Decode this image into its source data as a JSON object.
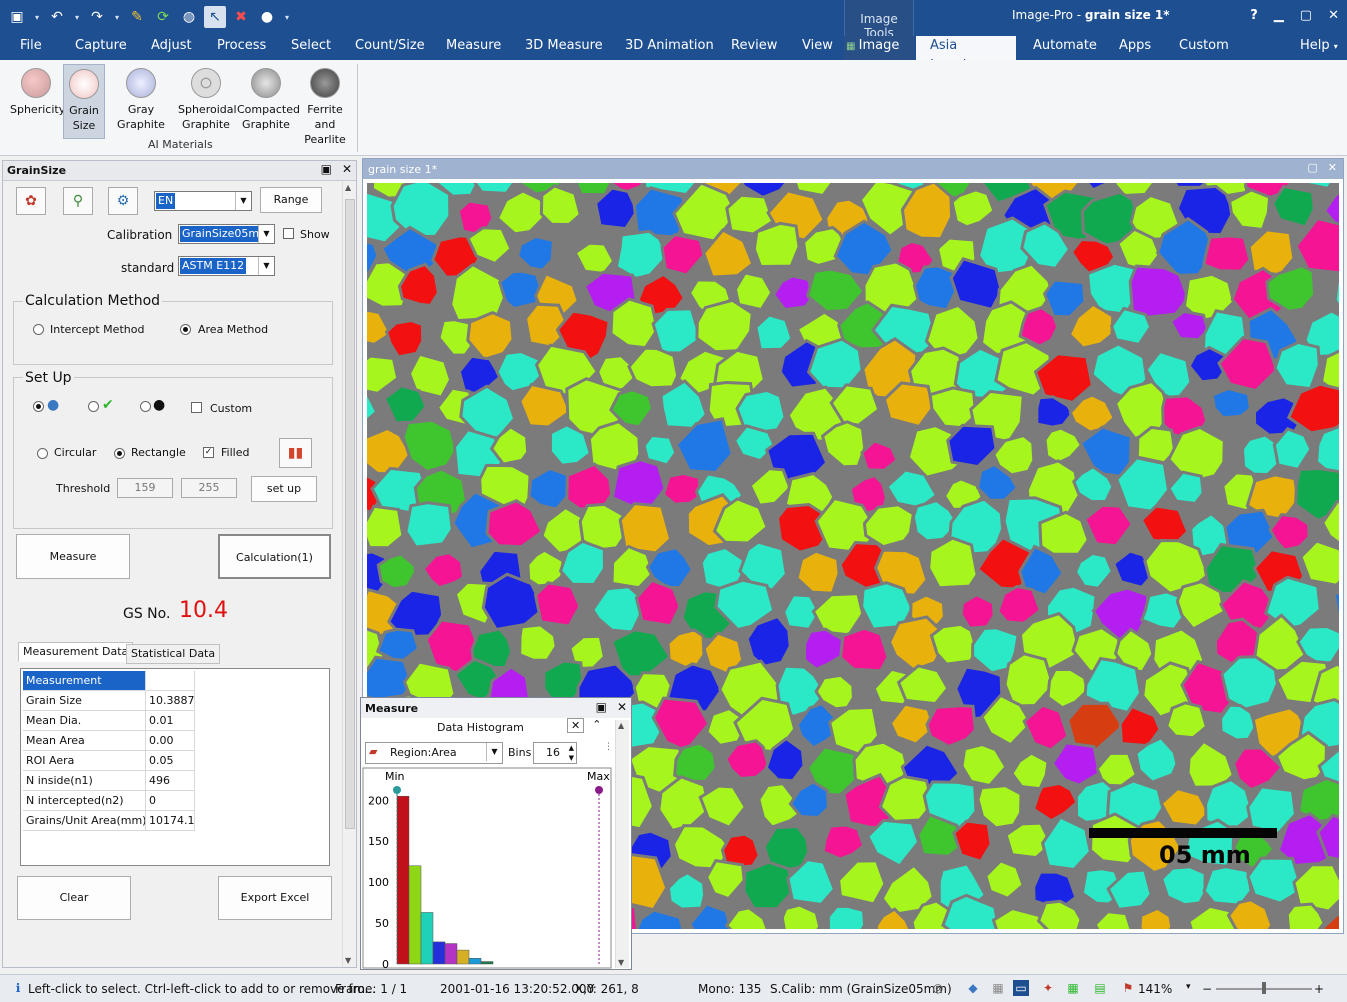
{
  "titlebar": {
    "image_tools": "Image Tools",
    "app_name": "Image-Pro - ",
    "doc_name": "grain size 1*",
    "controls": [
      "?",
      "▁",
      "▢",
      "✕"
    ]
  },
  "menu": [
    "File",
    "Capture",
    "Adjust",
    "Process",
    "Select",
    "Count/Size",
    "Measure",
    "3D Measure",
    "3D Animation",
    "Review",
    "View",
    "Image",
    "Asia Imaging",
    "Automate",
    "Apps",
    "Custom",
    "Help"
  ],
  "ribbon": {
    "buttons": [
      "Sphericity",
      "Grain Size",
      "Gray Graphite",
      "Spheroidal Graphite",
      "Compacted Graphite",
      "Ferrite and Pearlite"
    ],
    "group": "AI Materials"
  },
  "grain_panel": {
    "title": "GrainSize",
    "language": "EN",
    "range_btn": "Range",
    "calibration_label": "Calibration",
    "calibration_value": "GrainSize05mm",
    "show_label": "Show",
    "standard_label": "standard",
    "standard_value": "ASTM E112",
    "calc_method_title": "Calculation Method",
    "intercept_label": "Intercept Method",
    "area_label": "Area Method",
    "setup_title": "Set Up",
    "custom_label": "Custom",
    "circular_label": "Circular",
    "rectangle_label": "Rectangle",
    "filled_label": "Filled",
    "threshold_label": "Threshold",
    "threshold_min": "159",
    "threshold_max": "255",
    "setup_btn": "set up",
    "measure_btn": "Measure",
    "calculation_btn": "Calculation(1)",
    "gs_label": "GS No.",
    "gs_value": "10.4",
    "tab_measurement": "Measurement Data",
    "tab_statistical": "Statistical Data",
    "table_header": "Measurement",
    "rows": [
      {
        "k": "Grain Size",
        "v": "10.3887"
      },
      {
        "k": "Mean Dia.",
        "v": "0.01"
      },
      {
        "k": "Mean Area",
        "v": "0.00"
      },
      {
        "k": "ROI Aera",
        "v": "0.05"
      },
      {
        "k": "N inside(n1)",
        "v": "496"
      },
      {
        "k": "N intercepted(n2)",
        "v": "0"
      },
      {
        "k": "Grains/Unit Area(mm)",
        "v": "10174.1"
      }
    ],
    "clear_btn": "Clear",
    "export_btn": "Export Excel"
  },
  "image_window": {
    "title": "grain size 1*",
    "scale_text": "05 mm"
  },
  "measure_window": {
    "title": "Measure",
    "subtitle": "Data Histogram",
    "region_value": "Region:Area",
    "bins_label": "Bins",
    "bins_value": "16",
    "min_label": "Min",
    "max_label": "Max"
  },
  "chart_data": {
    "type": "bar",
    "x": [
      1,
      2,
      3,
      4,
      5,
      6,
      7,
      8
    ],
    "values": [
      205,
      120,
      63,
      27,
      25,
      17,
      7,
      3
    ],
    "y_ticks": [
      0,
      50,
      100,
      150,
      200
    ],
    "ylim": [
      0,
      215
    ]
  },
  "statusbar": {
    "hint": "Left-click to select. Ctrl-left-click to add to or remove fro...",
    "frame": "Frame: 1 / 1",
    "datetime": "2001-01-16 13:20:52.000",
    "xy": "X,Y:  261,   8",
    "mono": "Mono:  135",
    "calib": "S.Calib: mm (GrainSize05mm)",
    "zoom": "141%"
  },
  "colors": {
    "title_blue": "#1d4f91",
    "gs_red": "#e01010",
    "grain_palette": [
      "#a6f51d",
      "#2be8c6",
      "#f51493",
      "#e8b10c",
      "#1a24e6",
      "#1f78e6",
      "#b41ef0",
      "#3fc62e",
      "#10a94f",
      "#d63d10",
      "#f21010"
    ]
  }
}
